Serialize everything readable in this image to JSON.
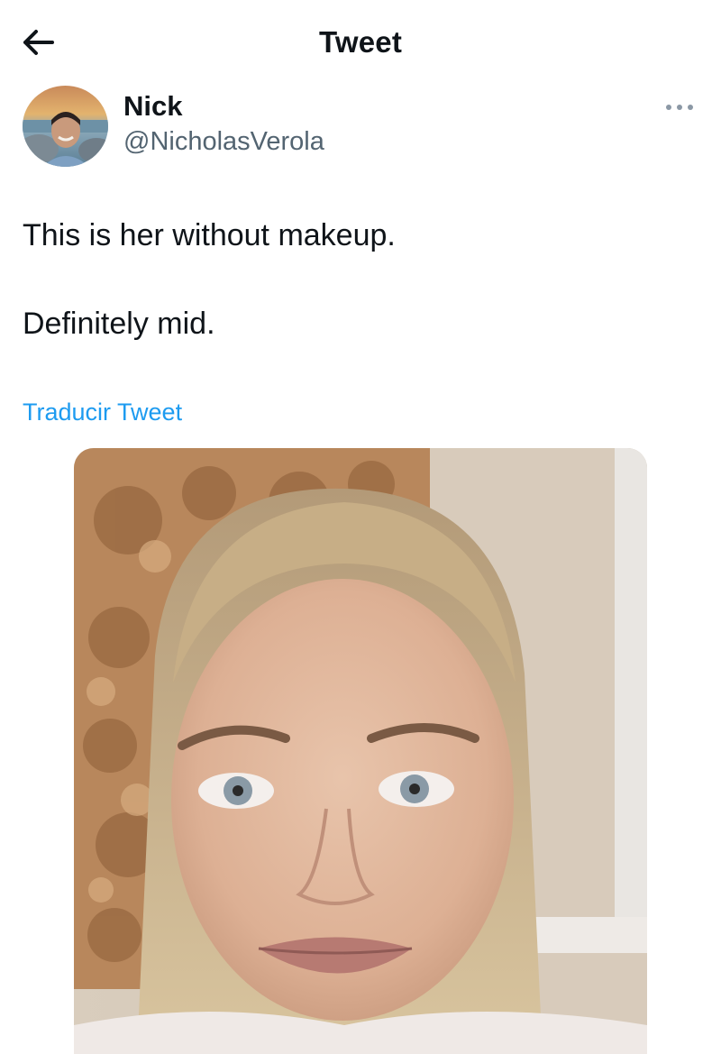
{
  "header": {
    "title": "Tweet",
    "back_icon": "arrow-left-icon"
  },
  "author": {
    "display_name": "Nick",
    "handle": "@NicholasVerola",
    "avatar_icon": "avatar"
  },
  "tweet": {
    "line1": "This is her without makeup.",
    "line2": "Definitely mid.",
    "translate_label": "Traducir Tweet",
    "more_icon": "more-horizontal-icon"
  },
  "colors": {
    "link": "#1d9bf0",
    "secondary_text": "#536471",
    "primary_text": "#0f1419",
    "background": "#ffffff"
  }
}
